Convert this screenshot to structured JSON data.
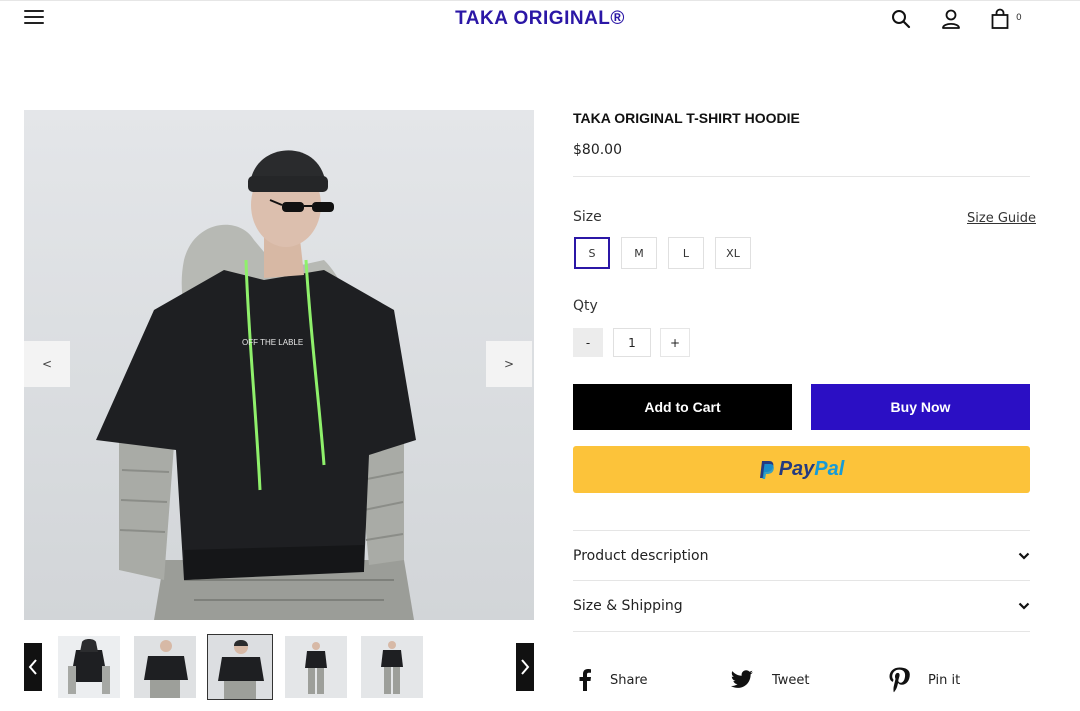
{
  "header": {
    "brand": "TAKA ORIGINAL®",
    "cart_count": "0"
  },
  "icons": {
    "menu": "hamburger-menu-icon",
    "search": "search-icon",
    "account": "user-icon",
    "cart": "shopping-bag-icon"
  },
  "gallery": {
    "prev_label": "<",
    "next_label": ">",
    "print_text": "OFF THE LABLE",
    "thumbnails": [
      "Thumbnail 1",
      "Thumbnail 2",
      "Thumbnail 3",
      "Thumbnail 4",
      "Thumbnail 5"
    ],
    "active_thumbnail": 3
  },
  "product": {
    "title": "TAKA ORIGINAL T-SHIRT HOODIE",
    "price": "$80.00",
    "size_label": "Size",
    "size_guide": "Size Guide",
    "sizes": [
      "S",
      "M",
      "L",
      "XL"
    ],
    "selected_size": "S",
    "qty_label": "Qty",
    "qty_minus": "-",
    "qty_value": "1",
    "qty_plus": "+"
  },
  "actions": {
    "add_to_cart": "Add to Cart",
    "buy_now": "Buy Now",
    "paypal_pay": "Pay",
    "paypal_pal": "Pal"
  },
  "accordion": [
    {
      "label": "Product description"
    },
    {
      "label": "Size & Shipping"
    }
  ],
  "share": {
    "facebook": "Share",
    "twitter": "Tweet",
    "pinterest": "Pin it"
  },
  "colors": {
    "brand": "#2b17a6",
    "buy_now": "#2b0fc4",
    "paypal_bg": "#fcc33a",
    "add_to_cart": "#000000"
  }
}
